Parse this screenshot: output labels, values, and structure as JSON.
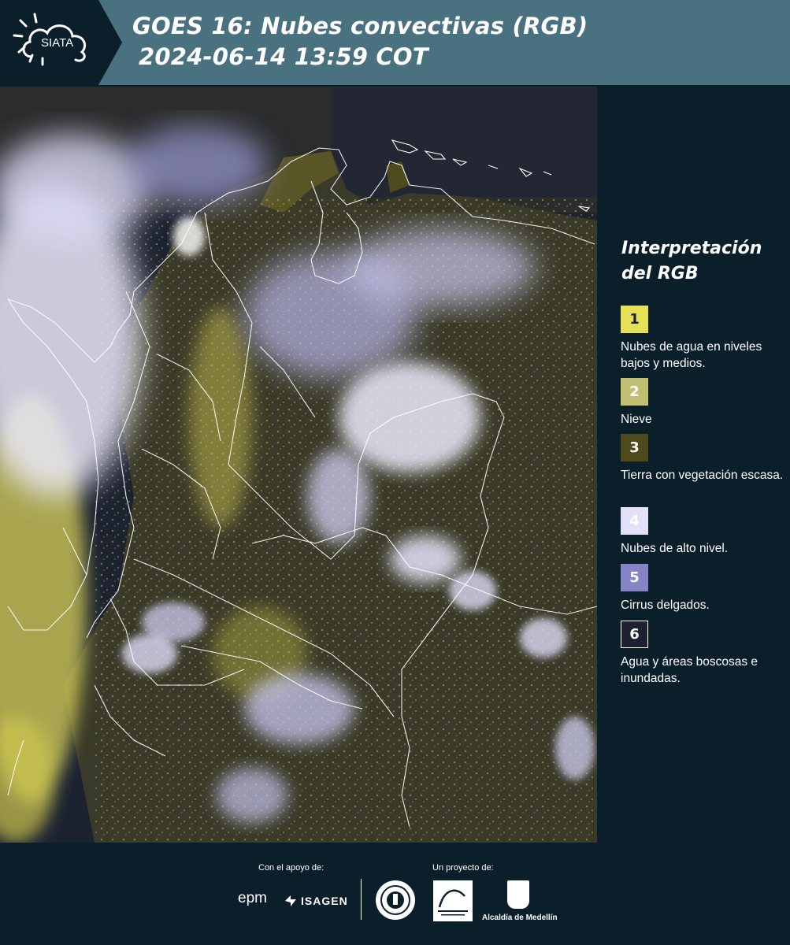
{
  "header": {
    "logo_text": "SIATA",
    "title_line1": "GOES 16: Nubes convectivas (RGB)",
    "title_line2": "2024-06-14 13:59 COT",
    "background_color": "#4a7180"
  },
  "legend": {
    "title": "Interpretación del RGB",
    "items": [
      {
        "number": "1",
        "label": "Nubes de agua en niveles bajos y medios.",
        "color": "#e6df58",
        "text_color": "#0b1f2b"
      },
      {
        "number": "2",
        "label": "Nieve",
        "color": "#c3bf71",
        "text_color": "#ffffff"
      },
      {
        "number": "3",
        "label": "Tierra con vegetación escasa.",
        "color": "#4e4a1b",
        "text_color": "#ffffff"
      },
      {
        "number": "4",
        "label": "Nubes de alto nivel.",
        "color": "#e3e1fa",
        "text_color": "#ffffff"
      },
      {
        "number": "5",
        "label": "Cirrus delgados.",
        "color": "#8584c6",
        "text_color": "#ffffff"
      },
      {
        "number": "6",
        "label": "Agua y áreas boscosas e inundadas.",
        "color": "#1e2131",
        "text_color": "#ffffff"
      }
    ]
  },
  "footer": {
    "support_label": "Con el apoyo de:",
    "project_label": "Un proyecto de:",
    "sponsors": [
      "epm",
      "ISAGEN"
    ],
    "partners": [
      "Área Metropolitana Valle de Aburrá",
      "Alcaldía de Medellín"
    ],
    "alcaldia_name": "Alcaldía de Medellín"
  },
  "colors": {
    "page_background": "#0b1f2b",
    "water_forest": "#1e2131",
    "low_clouds": "#e6df58",
    "high_clouds": "#e3e1fa",
    "cirrus": "#8584c6",
    "sparse_vegetation": "#4e4a1b"
  }
}
